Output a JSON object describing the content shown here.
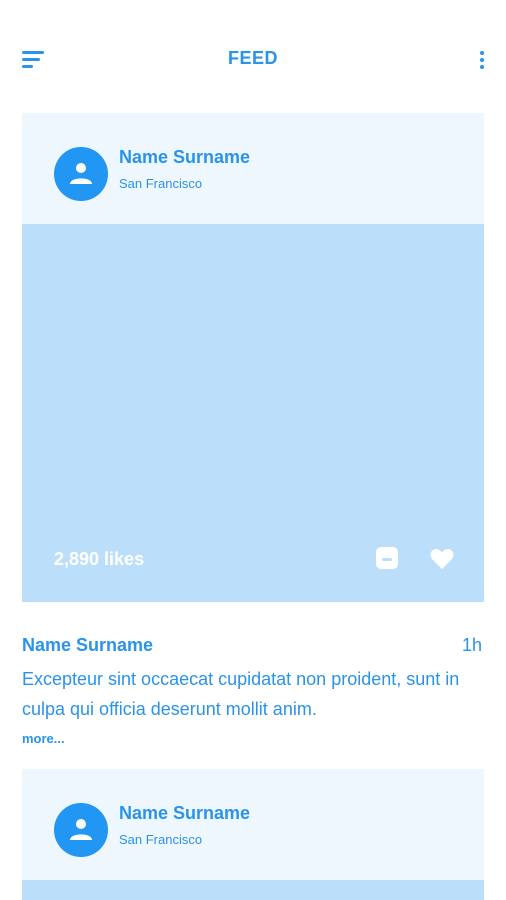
{
  "header": {
    "title": "FEED",
    "menu_icon": "hamburger-menu-icon",
    "more_icon": "more-vertical-icon"
  },
  "colors": {
    "accent": "#2a93ea",
    "avatar_bg": "#2196f3",
    "card_header_bg": "#eef7fe",
    "photo_placeholder": "#bbdffb"
  },
  "posts": [
    {
      "author": "Name Surname",
      "location": "San Francisco",
      "likes": "2,890 likes",
      "comment_icon": "comment-icon",
      "like_icon": "heart-icon",
      "caption_author": "Name Surname",
      "time": "1h",
      "caption": "Excepteur sint occaecat cupidatat non proident, sunt in culpa qui officia deserunt mollit anim.",
      "more_label": "more..."
    },
    {
      "author": "Name Surname",
      "location": "San Francisco"
    }
  ]
}
